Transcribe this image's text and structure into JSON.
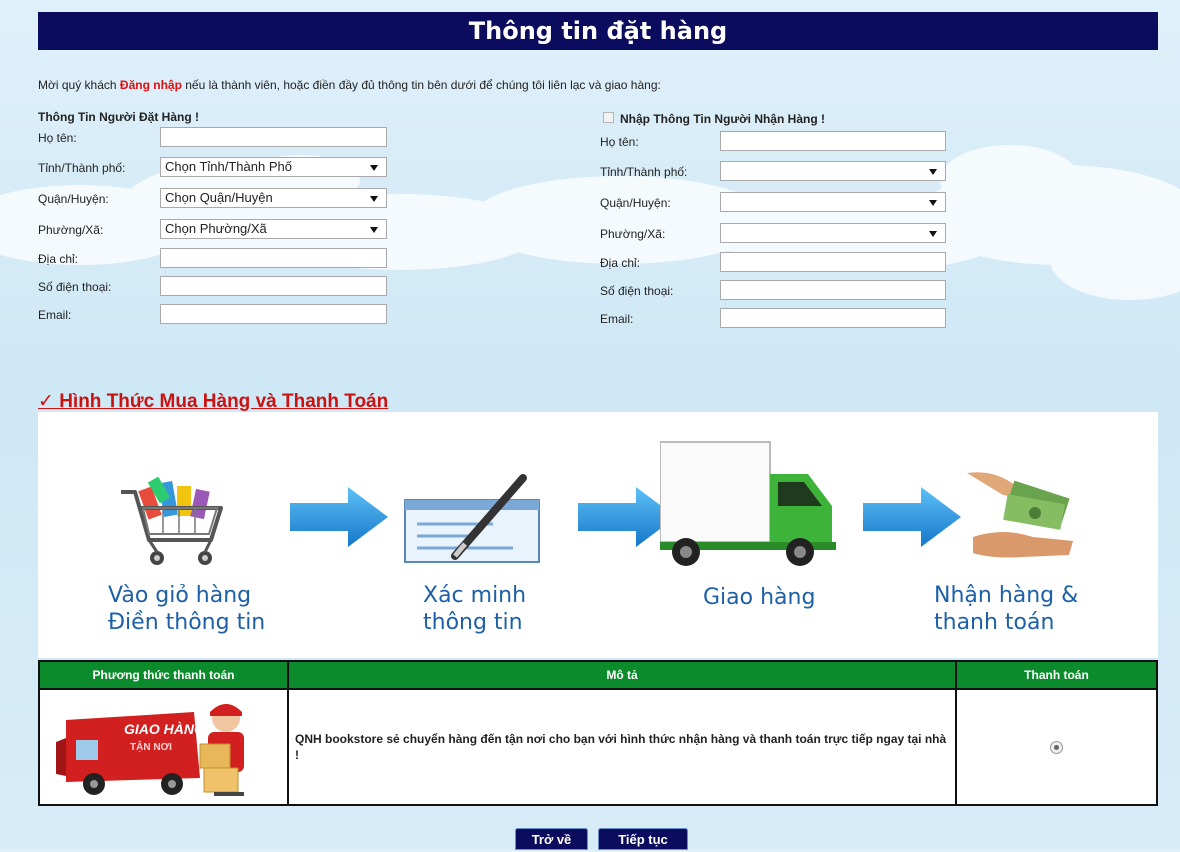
{
  "page_title": "Thông tin đặt hàng",
  "intro": {
    "before": "Mời quý khách ",
    "login_link": "Đăng nhập",
    "after": " nếu là thành viên, hoặc điền đầy đủ thông tin bên dưới để chúng tôi liên lạc và giao hàng:"
  },
  "buyer": {
    "heading": "Thông Tin Người Đặt Hàng !",
    "name_label": "Họ tên:",
    "city_label": "Tỉnh/Thành phố:",
    "city_value": "Chọn Tỉnh/Thành Phố",
    "district_label": "Quận/Huyện:",
    "district_value": "Chọn Quận/Huyện",
    "ward_label": "Phường/Xã:",
    "ward_value": "Chọn Phường/Xã",
    "address_label": "Địa chỉ:",
    "phone_label": "Số điện thoại:",
    "email_label": "Email:"
  },
  "receiver": {
    "heading": "Nhập Thông Tin Người Nhận Hàng !",
    "name_label": "Họ tên:",
    "city_label": "Tỉnh/Thành phố:",
    "district_label": "Quận/Huyện:",
    "ward_label": "Phường/Xã:",
    "address_label": "Địa chỉ:",
    "phone_label": "Số điện thoại:",
    "email_label": "Email:"
  },
  "payment": {
    "section_title": "✓ Hình Thức Mua Hàng và Thanh Toán",
    "steps": [
      {
        "line1": "Vào giỏ hàng",
        "line2": "Điền thông tin"
      },
      {
        "line1": "Xác minh",
        "line2": "thông tin"
      },
      {
        "line1": "Giao hàng",
        "line2": ""
      },
      {
        "line1": "Nhận hàng &",
        "line2": "thanh toán"
      }
    ],
    "truck_text1": "GIAO HÀNG",
    "truck_text2": "TẬN NƠI",
    "table": {
      "col_method": "Phương thức thanh toán",
      "col_desc": "Mô tả",
      "col_pay": "Thanh toán",
      "row_desc": "QNH bookstore sẻ chuyển hàng đến tận nơi cho bạn với hình thức nhận hàng và thanh toán trực tiếp ngay tại nhà !"
    }
  },
  "buttons": {
    "back": "Trở về",
    "next": "Tiếp tục"
  },
  "colors": {
    "title_bg": "#0c0c5e",
    "table_header": "#0b8b2b",
    "accent_red": "#e01010",
    "step_text": "#1d60a8"
  }
}
